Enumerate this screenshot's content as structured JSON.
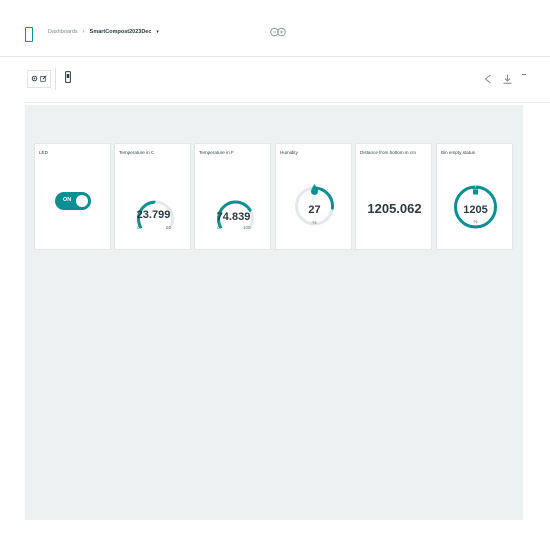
{
  "header": {
    "breadcrumb_root": "Dashboards",
    "breadcrumb_separator": "›",
    "breadcrumb_current": "SmartCompost2023Dec",
    "caret": "▾"
  },
  "toolbar": {
    "icons": [
      "settings-icon",
      "edit-icon",
      "mobile-icon",
      "share-icon",
      "download-icon"
    ]
  },
  "widgets": {
    "led": {
      "title": "LED",
      "state_label": "ON",
      "state": true
    },
    "temp_c": {
      "title": "Temperature in C",
      "value": "23.799",
      "min": "0",
      "max": "50",
      "fraction": 0.476
    },
    "temp_f": {
      "title": "Temperature in F",
      "value": "74.839",
      "min": "0",
      "max": "100",
      "fraction": 0.748
    },
    "humidity": {
      "title": "Humidity",
      "value": "27",
      "unit": "%",
      "fraction": 0.27
    },
    "distance": {
      "title": "Distance from bottom in cm",
      "value": "1205.062"
    },
    "bin": {
      "title": "Bin empty status",
      "value": "1205",
      "unit": "%",
      "fraction": 1.0
    }
  },
  "colors": {
    "accent": "#0a8f93",
    "track": "#e3e8ea",
    "canvas": "#edf1f2"
  }
}
